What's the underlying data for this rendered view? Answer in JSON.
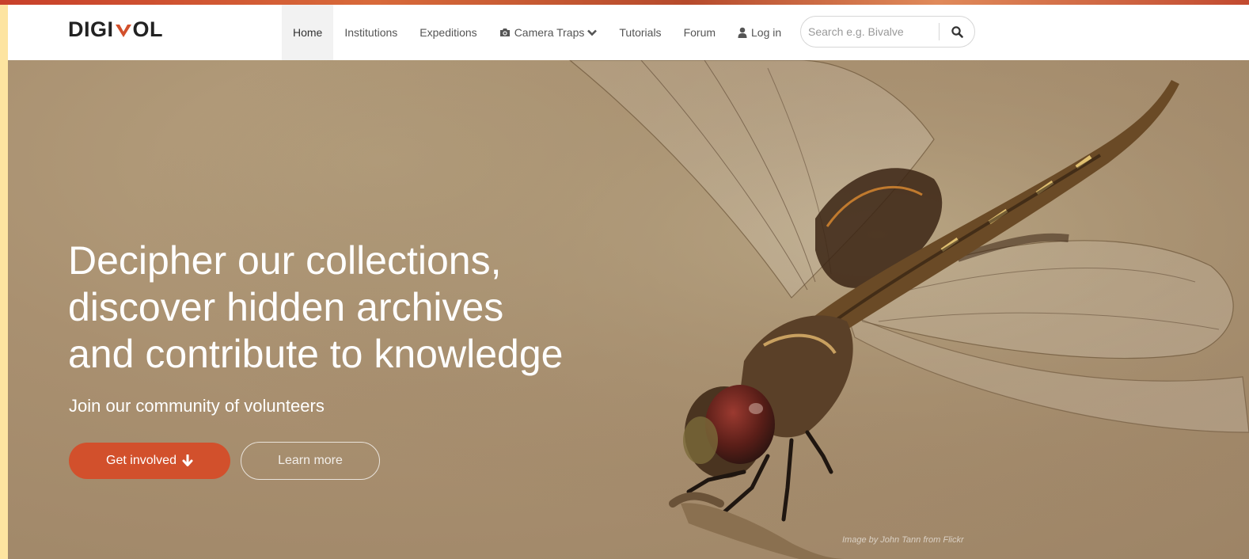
{
  "header": {
    "logo_left": "DIGI",
    "logo_right": "OL"
  },
  "nav": {
    "items": [
      {
        "label": "Home"
      },
      {
        "label": "Institutions"
      },
      {
        "label": "Expeditions"
      },
      {
        "label": "Camera Traps",
        "icon": "camera-icon",
        "dropdown": true
      },
      {
        "label": "Tutorials"
      },
      {
        "label": "Forum"
      },
      {
        "label": "Log in",
        "icon": "user-icon"
      }
    ]
  },
  "search": {
    "placeholder": "Search e.g. Bivalve",
    "value": "",
    "icon": "search-icon"
  },
  "hero": {
    "title_line1": "Decipher our collections,",
    "title_line2": "discover hidden archives",
    "title_line3": "and contribute to knowledge",
    "subtitle": "Join our community of volunteers",
    "primary_button": "Get involved",
    "primary_icon": "arrow-down-icon",
    "secondary_button": "Learn more",
    "image_credit": "Image by John Tann from Flickr"
  },
  "colors": {
    "accent": "#d2502c",
    "nav_text": "#555555",
    "hero_background": "#a99070"
  }
}
